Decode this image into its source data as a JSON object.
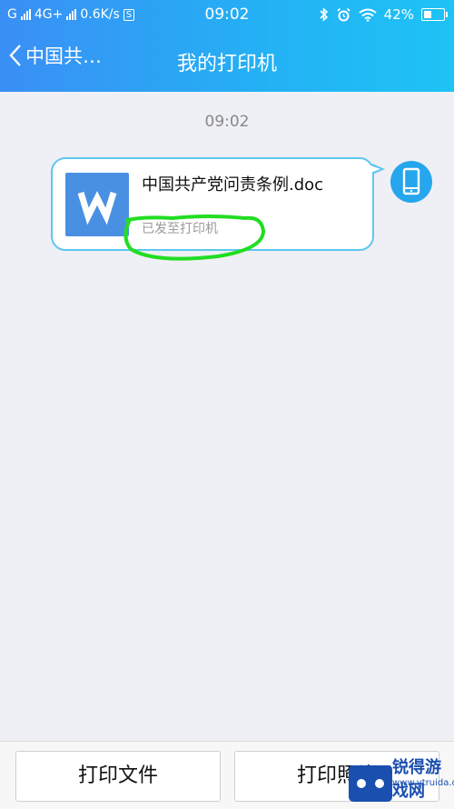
{
  "status_bar": {
    "carrier": "G",
    "network": "4G+",
    "speed": "0.6K/s",
    "sim_badge": "S",
    "time": "09:02",
    "battery": "42%",
    "icons": [
      "signal-icon",
      "bluetooth-icon",
      "alarm-icon",
      "wifi-icon",
      "battery-icon"
    ]
  },
  "nav": {
    "back_label": "中国共…",
    "title": "我的打印机"
  },
  "chat": {
    "timestamp": "09:02",
    "message": {
      "file_name": "中国共产党问责条例.doc",
      "status": "已发至打印机",
      "file_icon": "word-doc-icon"
    },
    "sender_icon": "phone-icon"
  },
  "bottom": {
    "print_file": "打印文件",
    "print_photo": "打印照片"
  },
  "watermark": {
    "brand": "锐得游戏网",
    "url": "www.ytruida.com"
  },
  "colors": {
    "header_start": "#3a8ff5",
    "header_end": "#1ec3f5",
    "bubble_border": "#5ec7ef",
    "word_blue": "#4a90e2",
    "annotation": "#22dd22"
  }
}
